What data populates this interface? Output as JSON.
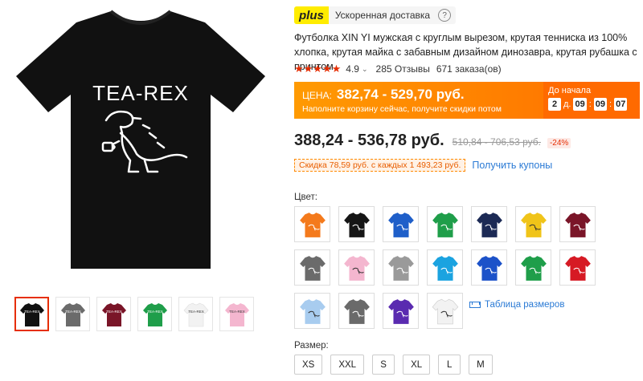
{
  "gallery": {
    "main_print_text": "TEA-REX",
    "shirt_color": "#111111",
    "thumbnails": [
      {
        "color": "#111111",
        "active": true
      },
      {
        "color": "#6b6b6b",
        "active": false
      },
      {
        "color": "#7a1528",
        "active": false
      },
      {
        "color": "#1f9e4a",
        "active": false
      },
      {
        "color": "#f2f2f2",
        "active": false
      },
      {
        "color": "#f4b6cf",
        "active": false
      }
    ]
  },
  "shipping": {
    "badge": "plus",
    "text": "Ускоренная доставка",
    "help": "?"
  },
  "product": {
    "title": "Футболка XIN YI мужская с круглым вырезом, крутая тенниска из 100% хлопка, крутая майка с забавным дизайном динозавра, крутая рубашка с принтом"
  },
  "rating": {
    "stars": "★★★★★",
    "value": "4.9",
    "chevron": "⌄",
    "reviews": "285 Отзывы",
    "orders": "671 заказа(ов)"
  },
  "promo": {
    "price_label": "ЦЕНА:",
    "price": "382,74 - 529,70 руб.",
    "subtitle": "Наполните корзину сейчас, получите скидки потом",
    "countdown_label": "До начала",
    "days": "2",
    "days_unit": "д.",
    "hours": "09",
    "minutes": "09",
    "seconds": "07",
    "sep": ":",
    "accent": "#ff7a00"
  },
  "price": {
    "current": "388,24 - 536,78 руб.",
    "old": "510,84 - 706,53 руб.",
    "discount": "-24%"
  },
  "coupon": {
    "badge": "Скидка 78,59 руб. с каждых 1 493,23 руб.",
    "link": "Получить купоны"
  },
  "colors": {
    "label": "Цвет:",
    "swatches": [
      "#f47a1c",
      "#161616",
      "#1f5fc9",
      "#1f9e4a",
      "#1c2a55",
      "#f0c419",
      "#7a1528",
      "#6b6b6b",
      "#f4b6cf",
      "#9a9a9a",
      "#1ba3e0",
      "#1c52c9",
      "#1f9e4a",
      "#d61a24",
      "#a8ccef",
      "#6a6a6a",
      "#5a2bb0",
      "#f2f2f2"
    ],
    "size_chart": "Таблица размеров"
  },
  "sizes": {
    "label": "Размер:",
    "options": [
      "XS",
      "XXL",
      "S",
      "XL",
      "L",
      "M"
    ]
  }
}
